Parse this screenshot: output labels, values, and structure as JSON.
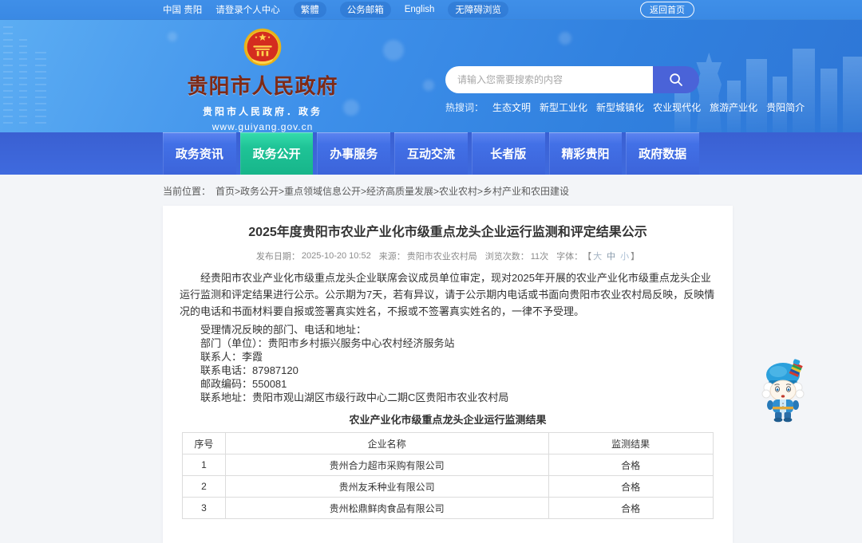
{
  "topbar": {
    "links": [
      {
        "label": "中国 贵阳",
        "pill": false
      },
      {
        "label": "请登录个人中心",
        "pill": false
      },
      {
        "label": "繁體",
        "pill": true
      },
      {
        "label": "公务邮箱",
        "pill": true
      },
      {
        "label": "English",
        "pill": false
      },
      {
        "label": "无障碍浏览",
        "pill": true
      }
    ],
    "home_button": "返回首页"
  },
  "header": {
    "site_name": "贵阳市人民政府",
    "site_subtitle": "贵阳市人民政府．政务",
    "site_url": "www.guiyang.gov.cn",
    "search_placeholder": "请输入您需要搜索的内容",
    "hot_label": "热搜词：",
    "hot_words": [
      "生态文明",
      "新型工业化",
      "新型城镇化",
      "农业现代化",
      "旅游产业化",
      "贵阳简介"
    ]
  },
  "nav": {
    "items": [
      {
        "label": "政务资讯",
        "active": false
      },
      {
        "label": "政务公开",
        "active": true
      },
      {
        "label": "办事服务",
        "active": false
      },
      {
        "label": "互动交流",
        "active": false
      },
      {
        "label": "长者版",
        "active": false
      },
      {
        "label": "精彩贵阳",
        "active": false
      },
      {
        "label": "政府数据",
        "active": false
      }
    ]
  },
  "breadcrumb": {
    "label": "当前位置：",
    "path": "首页>政务公开>重点领域信息公开>经济高质量发展>农业农村>乡村产业和农田建设"
  },
  "article": {
    "title": "2025年度贵阳市农业产业化市级重点龙头企业运行监测和评定结果公示",
    "meta": {
      "publish_label": "发布日期：",
      "publish_date": "2025-10-20 10:52",
      "source_label": "来源：",
      "source": "贵阳市农业农村局",
      "views_label": "浏览次数：",
      "views": "11次",
      "font_label": "字体：",
      "bracket_open": "【",
      "font_sizes": [
        "大",
        "中",
        "小"
      ],
      "bracket_close": "】"
    },
    "paragraphs": [
      {
        "type": "para",
        "text": "经贵阳市农业产业化市级重点龙头企业联席会议成员单位审定，现对2025年开展的农业产业化市级重点龙头企业运行监测和评定结果进行公示。公示期为7天，若有异议，请于公示期内电话或书面向贵阳市农业农村局反映，反映情况的电话和书面材料要自报或签署真实姓名，不报或不签署真实姓名的，一律不予受理。"
      },
      {
        "type": "line",
        "text": "受理情况反映的部门、电话和地址："
      },
      {
        "type": "line",
        "text": "部门（单位）：贵阳市乡村振兴服务中心农村经济服务站"
      },
      {
        "type": "line",
        "text": "联系人：李霞"
      },
      {
        "type": "line",
        "text": "联系电话：87987120"
      },
      {
        "type": "line",
        "text": "邮政编码：550081"
      },
      {
        "type": "line",
        "text": "联系地址：贵阳市观山湖区市级行政中心二期C区贵阳市农业农村局"
      }
    ],
    "table_caption": "农业产业化市级重点龙头企业运行监测结果",
    "table": {
      "headers": [
        "序号",
        "企业名称",
        "监测结果"
      ],
      "rows": [
        [
          "1",
          "贵州合力超市采购有限公司",
          "合格"
        ],
        [
          "2",
          "贵州友禾种业有限公司",
          "合格"
        ],
        [
          "3",
          "贵州松鼎鲜肉食品有限公司",
          "合格"
        ]
      ]
    }
  },
  "colors": {
    "topbar_blue": "#3f8fe8",
    "header_blue": "#3b8ce8",
    "nav_blue": "#3f6ade",
    "nav_active_green": "#1fc497",
    "search_button_indigo": "#4a63d8",
    "site_name_red": "#7e2a17",
    "emblem_red": "#d42d1f",
    "emblem_gold": "#f0bf2a"
  },
  "icons": {
    "search": "magnifier",
    "emblem": "china-national-emblem",
    "mascot": "ethnic-costume-mascot"
  }
}
